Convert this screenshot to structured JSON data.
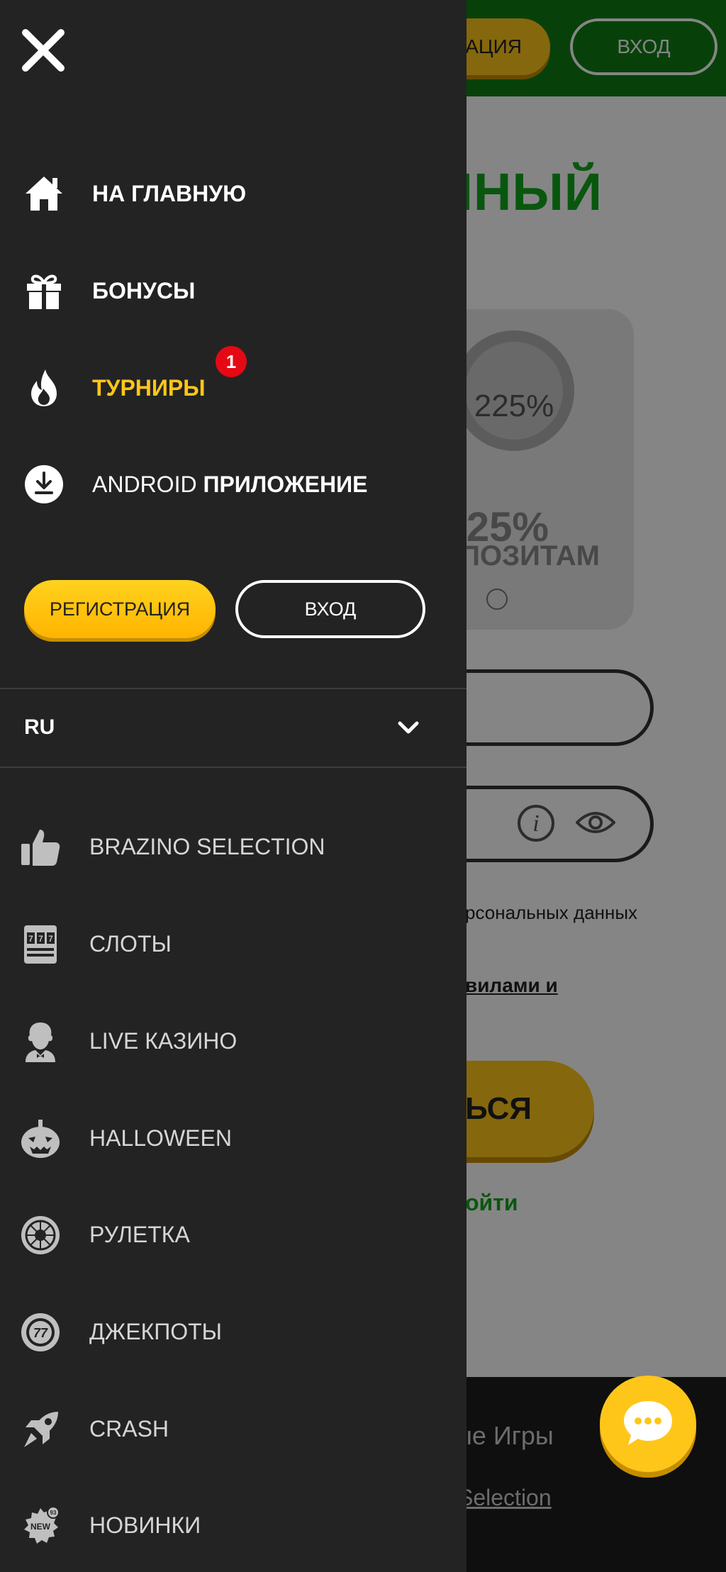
{
  "background": {
    "header": {
      "register_label": "РАЦИЯ",
      "login_label": "ВХОД"
    },
    "heading": "ННЫЙ",
    "promo": {
      "chip_text": "225%",
      "big_text": "225%",
      "sub_text": "ПОЗИТАМ"
    },
    "info_icon": "i",
    "personal_data_text": "рсональных данных",
    "rules_link": "вилами и",
    "submit_label": "ТЬСЯ",
    "login_link": "ойти",
    "footer": {
      "line1": "ые Игры",
      "line2": "Selection"
    }
  },
  "menu": {
    "primary": [
      {
        "id": "home",
        "label": "НА ГЛАВНУЮ",
        "icon": "home-icon"
      },
      {
        "id": "bonuses",
        "label": "БОНУСЫ",
        "icon": "gift-icon"
      },
      {
        "id": "tournaments",
        "label": "ТУРНИРЫ",
        "icon": "flame-icon",
        "badge": "1",
        "active": true
      },
      {
        "id": "android",
        "label_light": "ANDROID ",
        "label_bold": "ПРИЛОЖЕНИЕ",
        "icon": "download-icon"
      }
    ],
    "register_label": "РЕГИСТРАЦИЯ",
    "login_label": "ВХОД",
    "language": "RU",
    "categories": [
      {
        "label": "BRAZINO SELECTION",
        "icon": "thumbs-up-icon"
      },
      {
        "label": "СЛОТЫ",
        "icon": "slot-machine-icon"
      },
      {
        "label": "LIVE КАЗИНО",
        "icon": "dealer-icon"
      },
      {
        "label": "HALLOWEEN",
        "icon": "pumpkin-icon"
      },
      {
        "label": "РУЛЕТКА",
        "icon": "roulette-icon"
      },
      {
        "label": "ДЖЕКПОТЫ",
        "icon": "jackpot-icon",
        "icon_text": "77"
      },
      {
        "label": "CRASH",
        "icon": "rocket-icon"
      },
      {
        "label": "НОВИНКИ",
        "icon": "new-badge-icon",
        "icon_text": "NEW",
        "icon_count": "93"
      }
    ]
  },
  "colors": {
    "menu_bg": "#232323",
    "accent_yellow": "#ffc61a",
    "brand_green": "#0f7d13",
    "badge_red": "#e50914"
  }
}
